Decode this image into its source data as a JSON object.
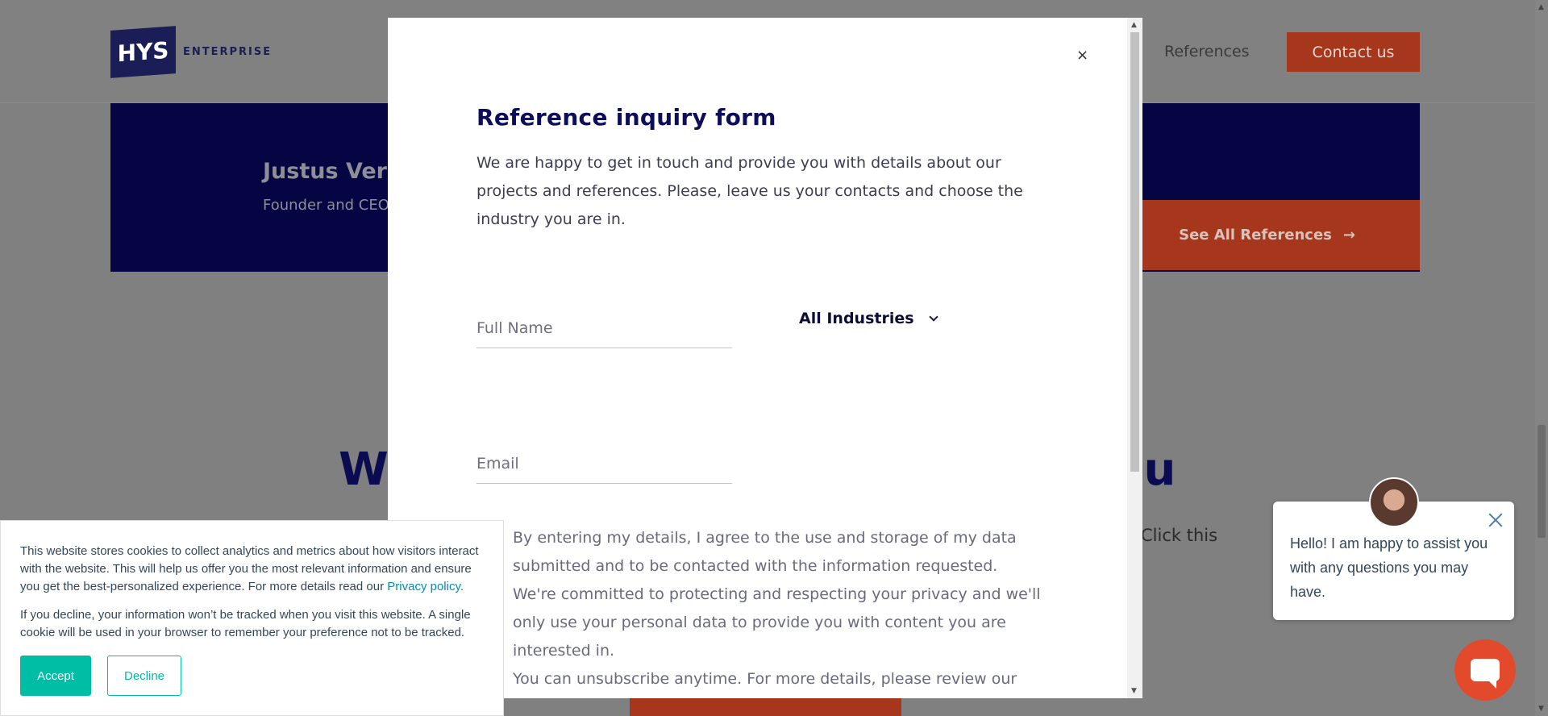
{
  "header": {
    "logo_mark": "HYS",
    "logo_text": "ENTERPRISE",
    "nav_references": "References",
    "contact_button": "Contact us"
  },
  "background": {
    "person_name": "Justus Verk",
    "person_role": "Founder and CEO",
    "see_all_label": "See All References",
    "see_all_arrow": "→",
    "heading_left": "We",
    "heading_right": "ou",
    "fragment": "Click this"
  },
  "modal": {
    "close_glyph": "×",
    "title": "Reference inquiry form",
    "intro": "We are happy to get in touch and provide you with details about our projects and references. Please, leave us your contacts and choose the industry you are in.",
    "full_name_placeholder": "Full Name",
    "email_placeholder": "Email",
    "industry_selected": "All Industries",
    "consent_1": "By entering my details, I agree to the use and storage of my data submitted and to be contacted with the information requested.",
    "consent_2": "We're committed to protecting and respecting your privacy and we'll only use your personal data to provide you with content you are interested in.",
    "consent_3": "You can unsubscribe anytime. For more details, please review our"
  },
  "cookie": {
    "text_1": "This website stores cookies to collect analytics and metrics about how visitors interact with the website. This will help us offer you the most relevant information and ensure you get the best-personalized experience. For more details read our",
    "privacy_link": "Privacy policy.",
    "text_2": "If you decline, your information won’t be tracked when you visit this website. A single cookie will be used in your browser to remember your preference not to be tracked.",
    "accept_label": "Accept",
    "decline_label": "Decline"
  },
  "chat": {
    "message": "Hello! I am happy to assist you with any questions you may have."
  },
  "colors": {
    "navy": "#0d0d5a",
    "brand_orange": "#e24a2b",
    "cookie_teal": "#00bda5"
  },
  "icons": {
    "modal_close": "close-icon",
    "select_caret": "chevron-down-icon",
    "see_all_arrow": "arrow-right-icon",
    "chat_close": "close-icon",
    "chat_launcher": "chat-bubble-icon"
  }
}
